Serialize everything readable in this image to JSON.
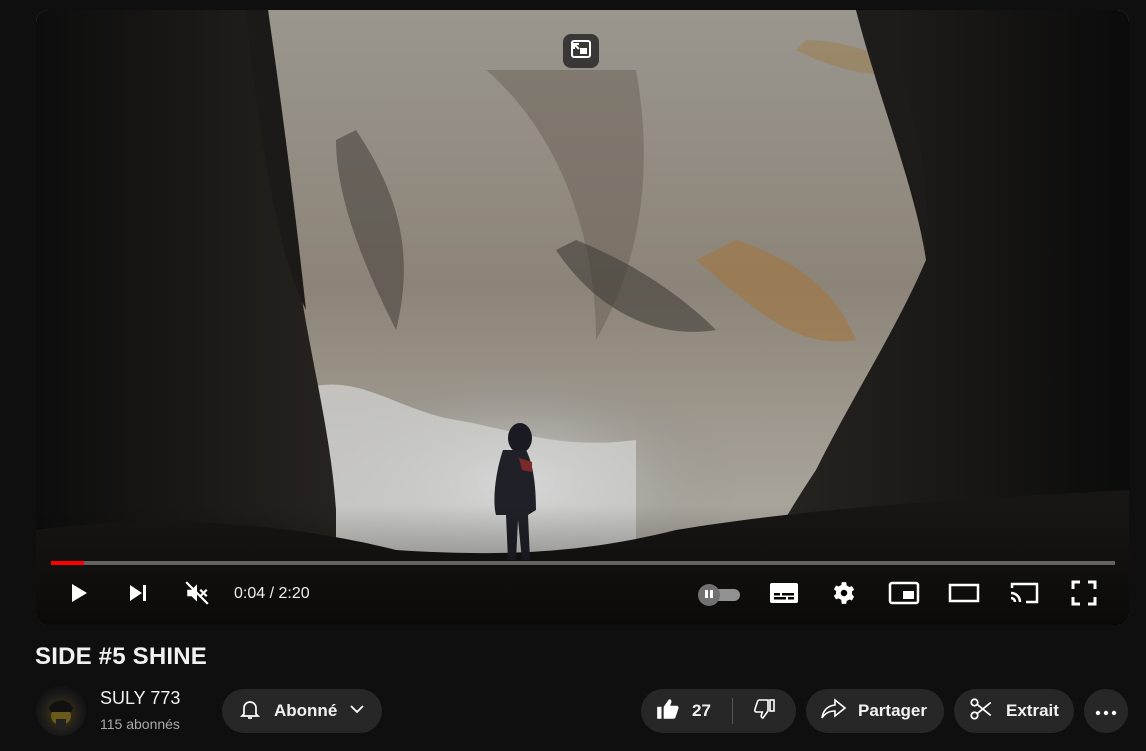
{
  "player": {
    "time_current": "0:04",
    "time_separator": " / ",
    "time_total": "2:20",
    "progress_fraction": 0.031,
    "colors": {
      "progress": "#ff0000"
    },
    "icons": {
      "play": "play-icon",
      "next": "next-icon",
      "mute": "muted-volume-icon",
      "autoplay": "autoplay-toggle-icon",
      "subtitles": "subtitles-icon",
      "settings": "gear-icon",
      "miniplayer": "miniplayer-icon",
      "theater": "theater-mode-icon",
      "cast": "cast-icon",
      "fullscreen": "fullscreen-icon",
      "pip_exit": "exit-picture-in-picture-icon"
    }
  },
  "video": {
    "title": "SIDE #5 SHINE"
  },
  "channel": {
    "name": "SULY 773",
    "subscribers": "115 abonnés"
  },
  "actions": {
    "subscribe_label": "Abonné",
    "like_count": "27",
    "share_label": "Partager",
    "clip_label": "Extrait"
  }
}
